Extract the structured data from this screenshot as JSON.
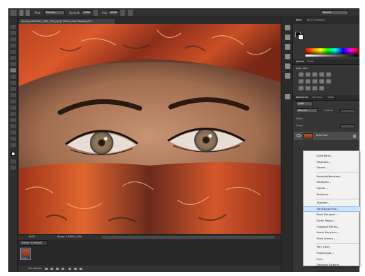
{
  "options_bar": {
    "mode_label": "Mod:",
    "mode_value": "Normal",
    "opacity_label": "Opaklık:",
    "opacity_value": "100%",
    "flow_label": "Akış:",
    "flow_value": "100%",
    "workspace_value": "Tasarla"
  },
  "document": {
    "tab_title": "beauty-1693049_960_720.jpg @ 100% (Hale Masked/8) *",
    "zoom": "100%",
    "doc_info": "Belge: 1,63M/1,63M"
  },
  "timeline": {
    "tab_label": "Zaman Çizelgesi",
    "frame_time": "0 san.",
    "loop_label": "Her zaman"
  },
  "panels": {
    "color_tabs": [
      "Renk",
      "Renk Örnekleri"
    ],
    "adjust_tabs": [
      "Ayarlar",
      "Stiller"
    ],
    "adjust_title": "Ayar ekle",
    "layer_tabs": [
      "Katmanlar",
      "Kanallar",
      "Yollar"
    ],
    "layer_filter": "Çeşit",
    "blend_mode": "Normal",
    "opacity_label": "Opaklık:",
    "lock_label": "Kilitle:",
    "fill_label": "Dolgu:",
    "background_layer": "Arka Plan"
  },
  "context_menu": {
    "groups": [
      [
        "Solid Renk...",
        "Degrade...",
        "Desen..."
      ],
      [
        "Parlaklık/Kontrast...",
        "Düzeyler...",
        "Eğriler...",
        "Pozlama..."
      ],
      [
        "Titreşim...",
        "Ton/Doygunluk...",
        "Renk Dengesi...",
        "Siyah Beyaz...",
        "Fotoğraf Filtresi...",
        "Kanal Karıştırıcı...",
        "Renk Arama..."
      ],
      [
        "Ters Çevir",
        "Posterleştir...",
        "Eşik...",
        "Degrade Eşleme...",
        "Seçmeli Renk..."
      ]
    ],
    "highlighted": "Ton/Doygunluk..."
  },
  "colors": {
    "ui_dark": "#2b2b2b",
    "menu_bg": "#f2f2f2",
    "menu_highlight": "#cfe3ff"
  }
}
